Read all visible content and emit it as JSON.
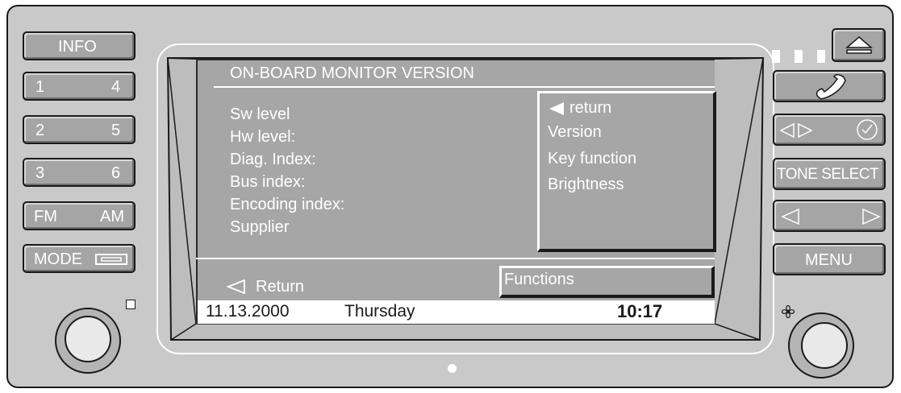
{
  "left_buttons": {
    "info": "INFO",
    "preset_1": "1",
    "preset_4": "4",
    "preset_2": "2",
    "preset_5": "5",
    "preset_3": "3",
    "preset_6": "6",
    "fm": "FM",
    "am": "AM",
    "mode": "MODE"
  },
  "right_buttons": {
    "tone_select": "TONE SELECT",
    "menu": "MENU"
  },
  "screen": {
    "title": "ON-BOARD MONITOR VERSION",
    "info_items": [
      "Sw level",
      "Hw level:",
      "Diag. Index:",
      "Bus index:",
      "Encoding index:",
      "Supplier"
    ],
    "menu_items": [
      "return",
      "Version",
      "Key function",
      "Brightness"
    ],
    "return_label": "Return",
    "functions_label": "Functions",
    "status": {
      "date": "11.13.2000",
      "day": "Thursday",
      "time": "10:17"
    }
  },
  "icons": {
    "eject": "eject-icon",
    "phone": "phone-icon",
    "seek": "seek-icon",
    "clock": "clock-icon",
    "prev": "left-arrow-icon",
    "next": "right-arrow-icon",
    "fan": "fan-icon",
    "cassette": "cassette-icon",
    "arrow": "left-triangle-icon"
  },
  "colors": {
    "bezel": "#c9c9c9",
    "screen": "#a6a6a6",
    "button": "#a5a5a5",
    "text": "#ffffff"
  }
}
